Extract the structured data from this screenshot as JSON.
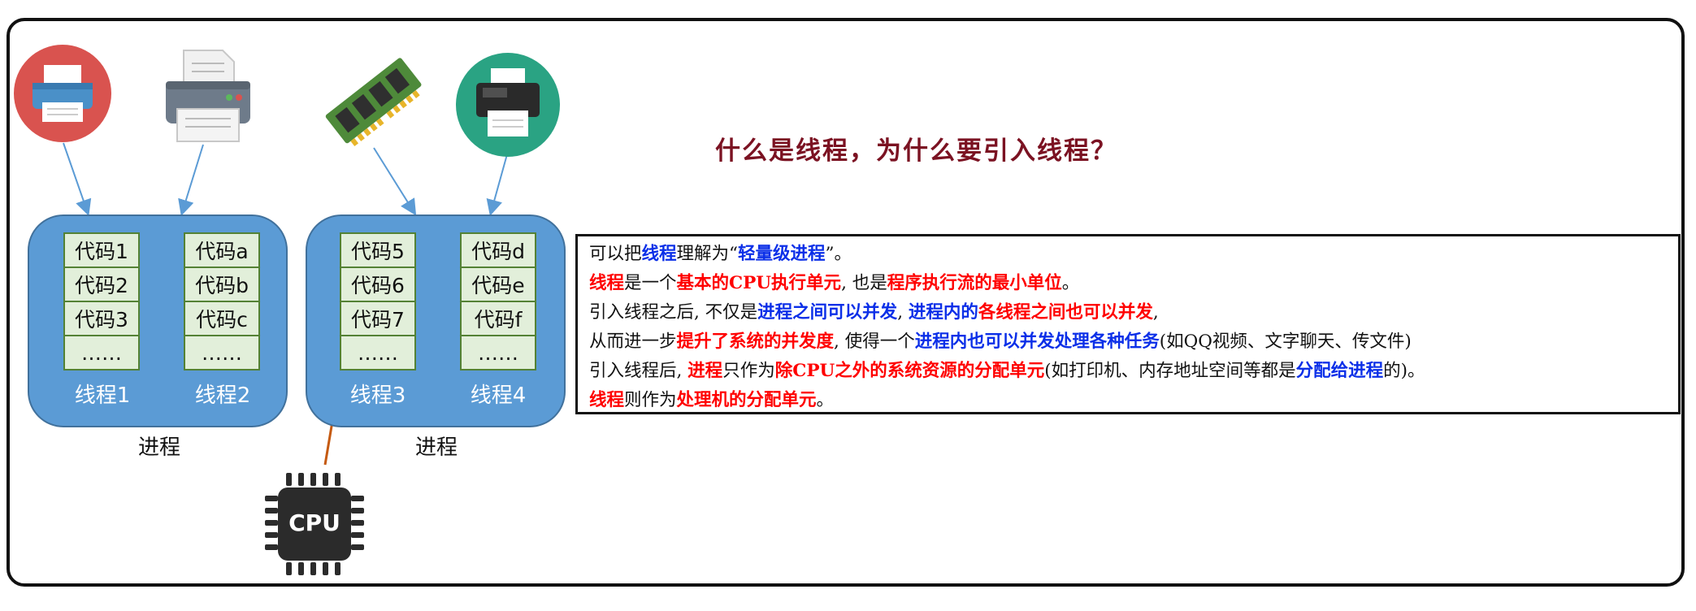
{
  "title": "什么是线程，为什么要引入线程？",
  "processes": [
    {
      "label": "进程",
      "threads": [
        {
          "label": "线程1",
          "cells": [
            "代码1",
            "代码2",
            "代码3",
            "……"
          ]
        },
        {
          "label": "线程2",
          "cells": [
            "代码a",
            "代码b",
            "代码c",
            "……"
          ]
        }
      ]
    },
    {
      "label": "进程",
      "threads": [
        {
          "label": "线程3",
          "cells": [
            "代码5",
            "代码6",
            "代码7",
            "……"
          ]
        },
        {
          "label": "线程4",
          "cells": [
            "代码d",
            "代码e",
            "代码f",
            "……"
          ]
        }
      ]
    }
  ],
  "cpu_label": "CPU",
  "icons": [
    "printer-red-icon",
    "printer-gray-icon",
    "memory-stick-icon",
    "printer-teal-icon",
    "cpu-chip-icon"
  ],
  "colors": {
    "accent_red": "#ff0000",
    "accent_blue": "#0b2fe8",
    "title": "#7b1222",
    "process_fill": "#5b9bd5",
    "code_fill": "#e2efda"
  },
  "explanation": [
    [
      {
        "t": "可以把",
        "c": "n"
      },
      {
        "t": "线程",
        "c": "b"
      },
      {
        "t": "理解为“",
        "c": "n"
      },
      {
        "t": "轻量级进程",
        "c": "b"
      },
      {
        "t": "”。",
        "c": "n"
      }
    ],
    [
      {
        "t": "线程",
        "c": "r"
      },
      {
        "t": "是一个",
        "c": "n"
      },
      {
        "t": "基本的CPU执行单元",
        "c": "r"
      },
      {
        "t": ", 也是",
        "c": "n"
      },
      {
        "t": "程序执行流的最小单位",
        "c": "r"
      },
      {
        "t": "。",
        "c": "n"
      }
    ],
    [
      {
        "t": "引入线程之后, 不仅是",
        "c": "n"
      },
      {
        "t": "进程之间可以并发",
        "c": "b"
      },
      {
        "t": ", ",
        "c": "n"
      },
      {
        "t": "进程内的",
        "c": "b"
      },
      {
        "t": "各线程之间也可以并发",
        "c": "r"
      },
      {
        "t": ",",
        "c": "n"
      }
    ],
    [
      {
        "t": "从而进一步",
        "c": "n"
      },
      {
        "t": "提升了系统的并发度",
        "c": "r"
      },
      {
        "t": ", 使得一个",
        "c": "n"
      },
      {
        "t": "进程内也可以并发处理各种任务",
        "c": "b"
      },
      {
        "t": "(如QQ视频、文字聊天、传文件)",
        "c": "n"
      }
    ],
    [
      {
        "t": "引入线程后, ",
        "c": "n"
      },
      {
        "t": "进程",
        "c": "r"
      },
      {
        "t": "只作为",
        "c": "n"
      },
      {
        "t": "除CPU之外的系统资源的分配单元",
        "c": "r"
      },
      {
        "t": "(如打印机、内存地址空间等都是",
        "c": "n"
      },
      {
        "t": "分配给进程",
        "c": "b"
      },
      {
        "t": "的)。",
        "c": "n"
      }
    ],
    [
      {
        "t": "线程",
        "c": "r"
      },
      {
        "t": "则作为",
        "c": "n"
      },
      {
        "t": "处理机的分配单元",
        "c": "r"
      },
      {
        "t": "。",
        "c": "n"
      }
    ]
  ]
}
